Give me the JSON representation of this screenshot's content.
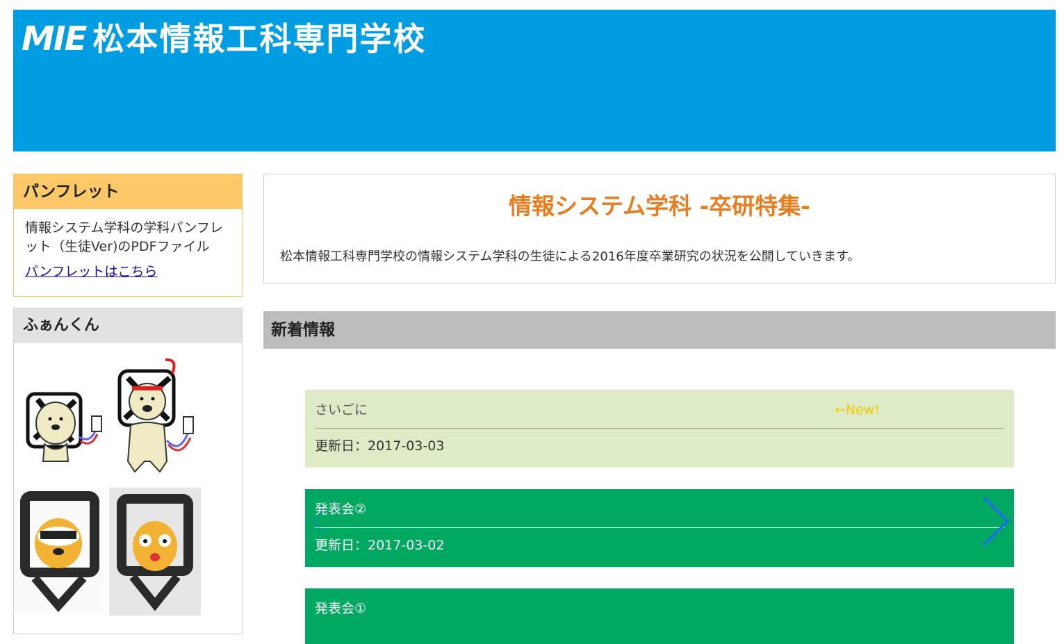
{
  "header": {
    "logo_mark": "MIE",
    "school_name": "松本情報工科専門学校",
    "bg_color": "#009de3"
  },
  "sidebar": {
    "pamphlet": {
      "heading": "パンフレット",
      "description": "情報システム学科の学科パンフレット（生徒Ver)のPDFファイル",
      "link": "パンフレットはこちら"
    },
    "fan": {
      "heading": "ふぁんくん"
    }
  },
  "main": {
    "intro": {
      "title": "情報システム学科 -卒研特集-",
      "text": "松本情報工科専門学校の情報システム学科の生徒による2016年度卒業研究の状況を公開していきます。"
    },
    "news": {
      "heading": "新着情報",
      "items": [
        {
          "title": "さいごに",
          "badge": "←New!",
          "date": "更新日：2017-03-03"
        },
        {
          "title": "発表会②",
          "date": "更新日：2017-03-02"
        },
        {
          "title": "発表会①"
        }
      ]
    }
  },
  "colors": {
    "accent_orange": "#e87c1e",
    "card_green": "#00a862",
    "card_light": "#ddebc6",
    "pamphlet_head": "#fdc968"
  },
  "icons": [
    "chevron-right-icon",
    "chevron-left-icon"
  ]
}
